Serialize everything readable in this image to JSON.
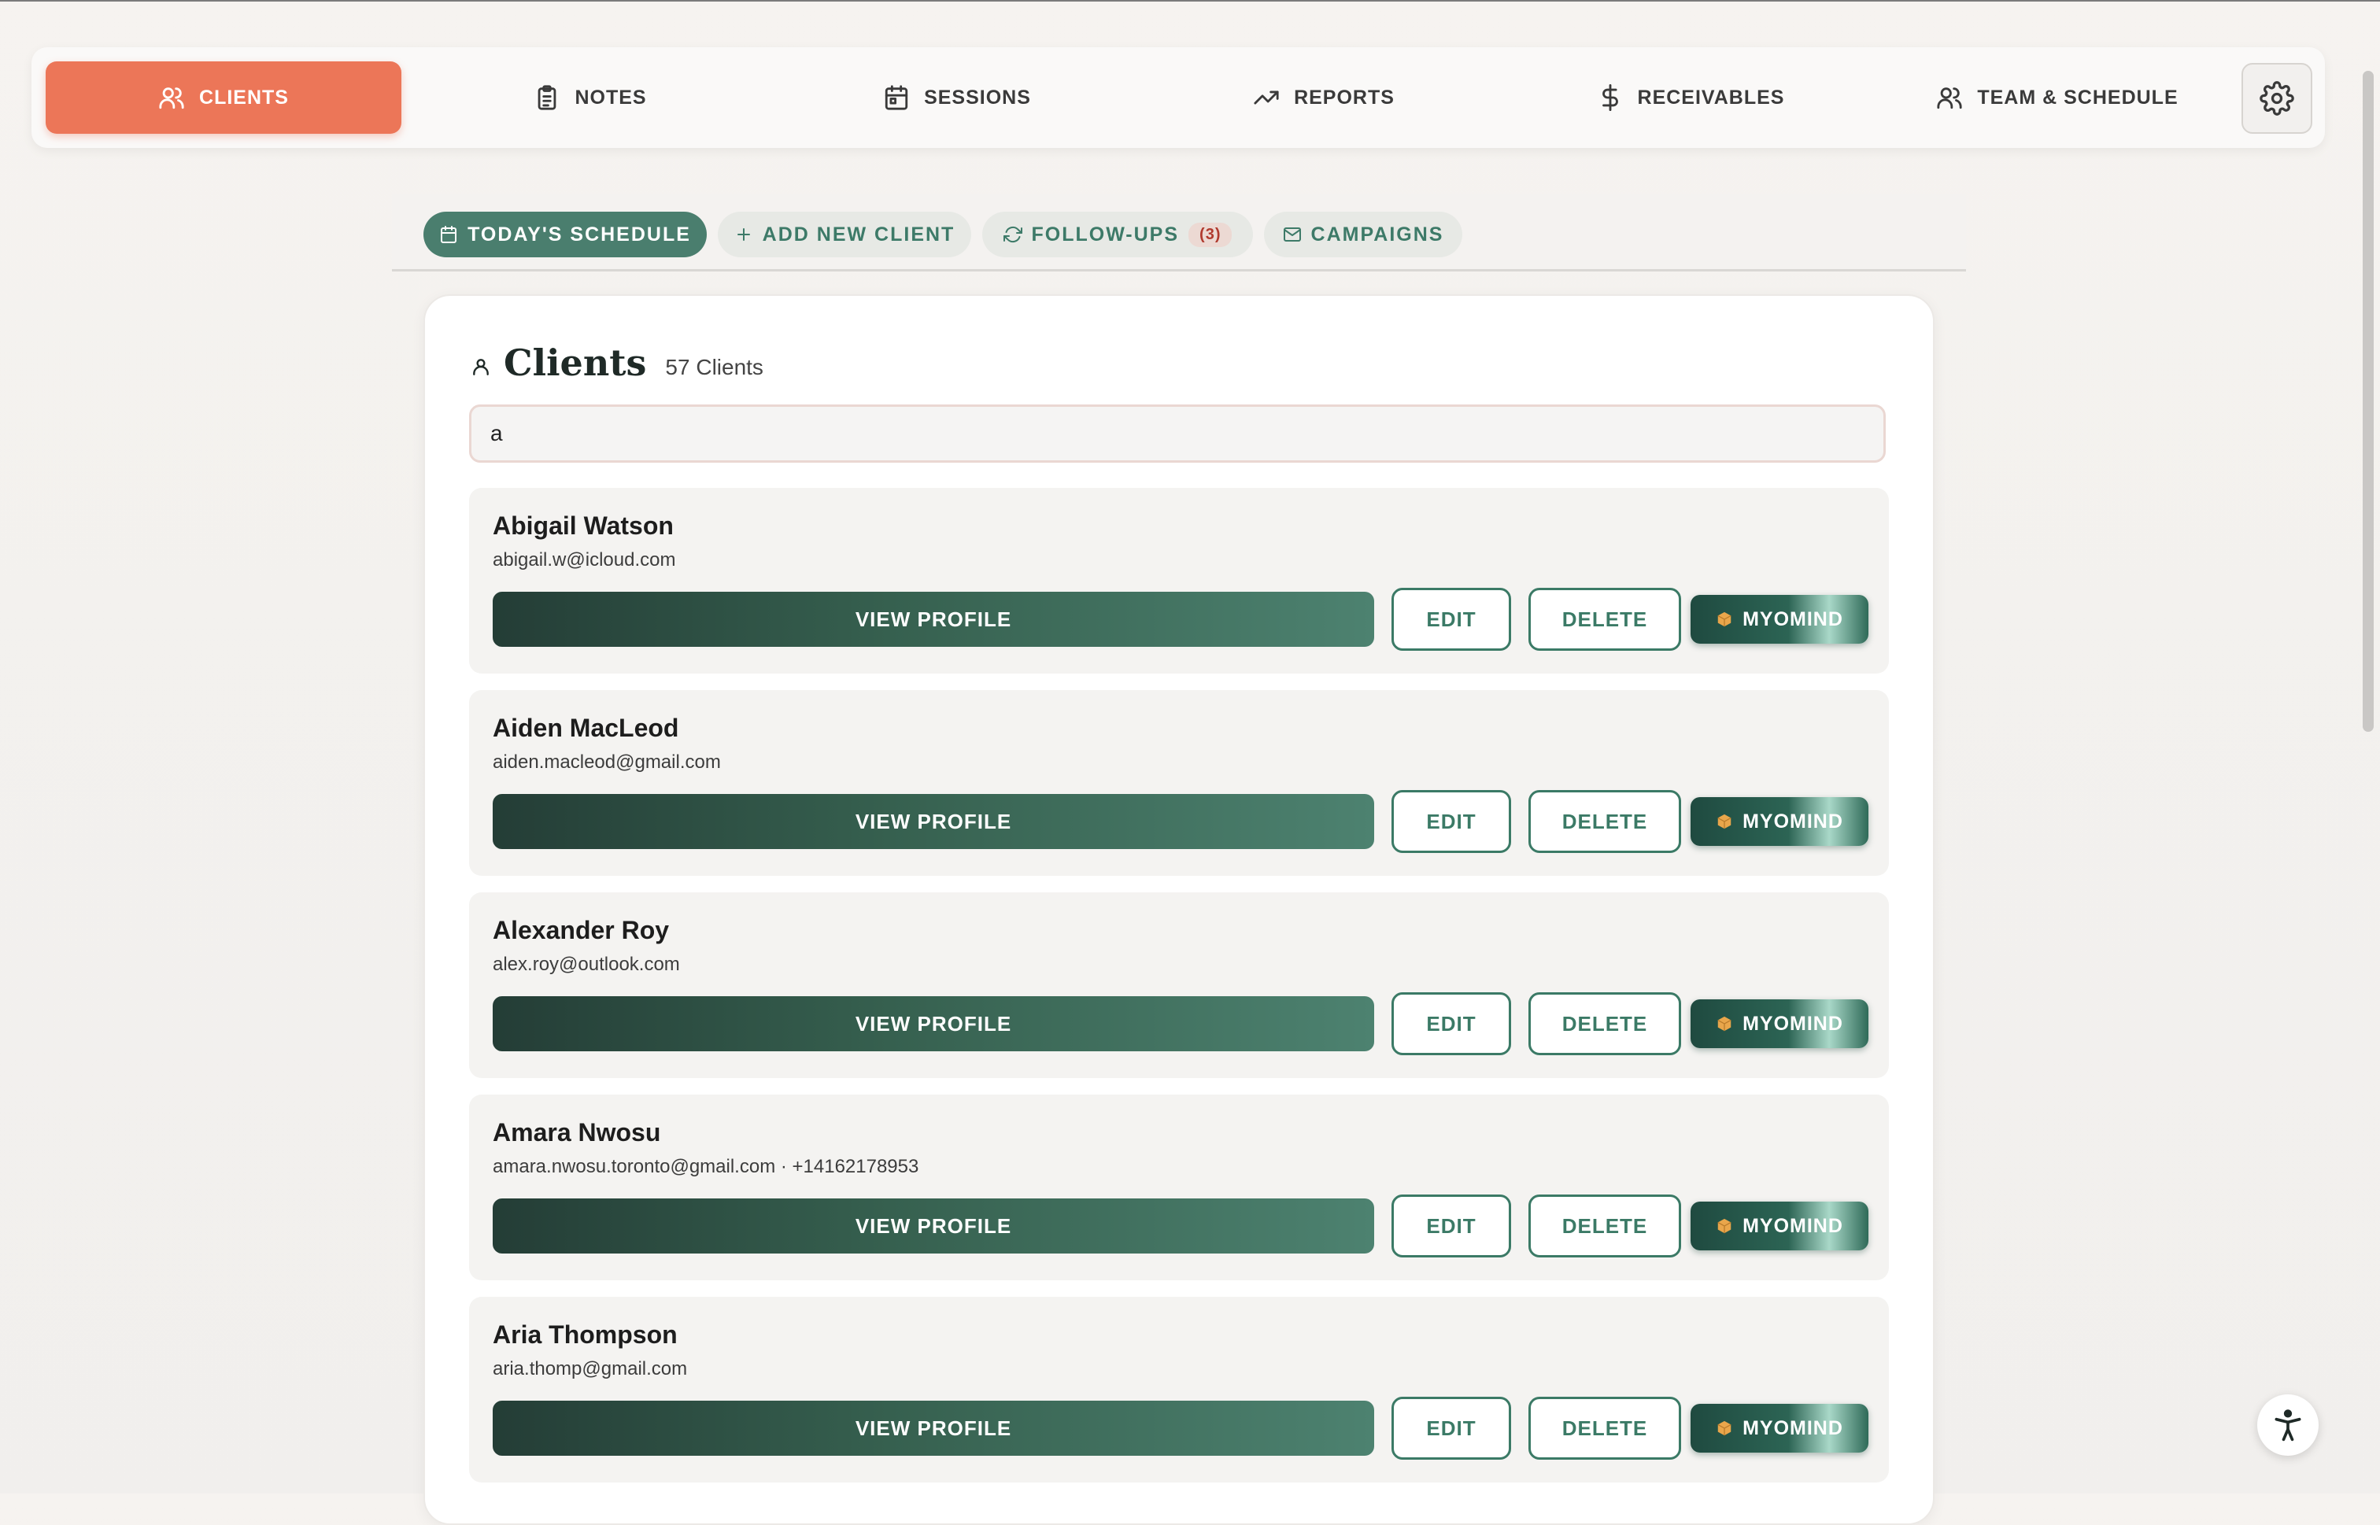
{
  "nav": {
    "tabs": [
      {
        "label": "CLIENTS",
        "icon": "users-icon",
        "active": true
      },
      {
        "label": "NOTES",
        "icon": "clipboard-icon",
        "active": false
      },
      {
        "label": "SESSIONS",
        "icon": "calendar-icon",
        "active": false
      },
      {
        "label": "REPORTS",
        "icon": "trending-up-icon",
        "active": false
      },
      {
        "label": "RECEIVABLES",
        "icon": "dollar-icon",
        "active": false
      },
      {
        "label": "TEAM & SCHEDULE",
        "icon": "team-icon",
        "active": false
      }
    ],
    "settings_icon": "gear-icon"
  },
  "subtabs": {
    "todays_schedule": "TODAY'S SCHEDULE",
    "add_new_client": "ADD NEW CLIENT",
    "follow_ups": "FOLLOW-UPS",
    "follow_ups_count": "(3)",
    "campaigns": "CAMPAIGNS"
  },
  "clients_panel": {
    "title": "Clients",
    "count_label": "57 Clients",
    "search_value": "a",
    "buttons": {
      "view_profile": "VIEW PROFILE",
      "edit": "EDIT",
      "delete": "DELETE",
      "myomind": "MYOMIND"
    },
    "clients": [
      {
        "name": "Abigail Watson",
        "contact": "abigail.w@icloud.com"
      },
      {
        "name": "Aiden MacLeod",
        "contact": "aiden.macleod@gmail.com"
      },
      {
        "name": "Alexander Roy",
        "contact": "alex.roy@outlook.com"
      },
      {
        "name": "Amara Nwosu",
        "contact": "amara.nwosu.toronto@gmail.com · +14162178953"
      },
      {
        "name": "Aria Thompson",
        "contact": "aria.thomp@gmail.com"
      }
    ]
  },
  "colors": {
    "accent": "#ec7658",
    "primary_green": "#3b7a66",
    "dark_green": "#243d36"
  }
}
